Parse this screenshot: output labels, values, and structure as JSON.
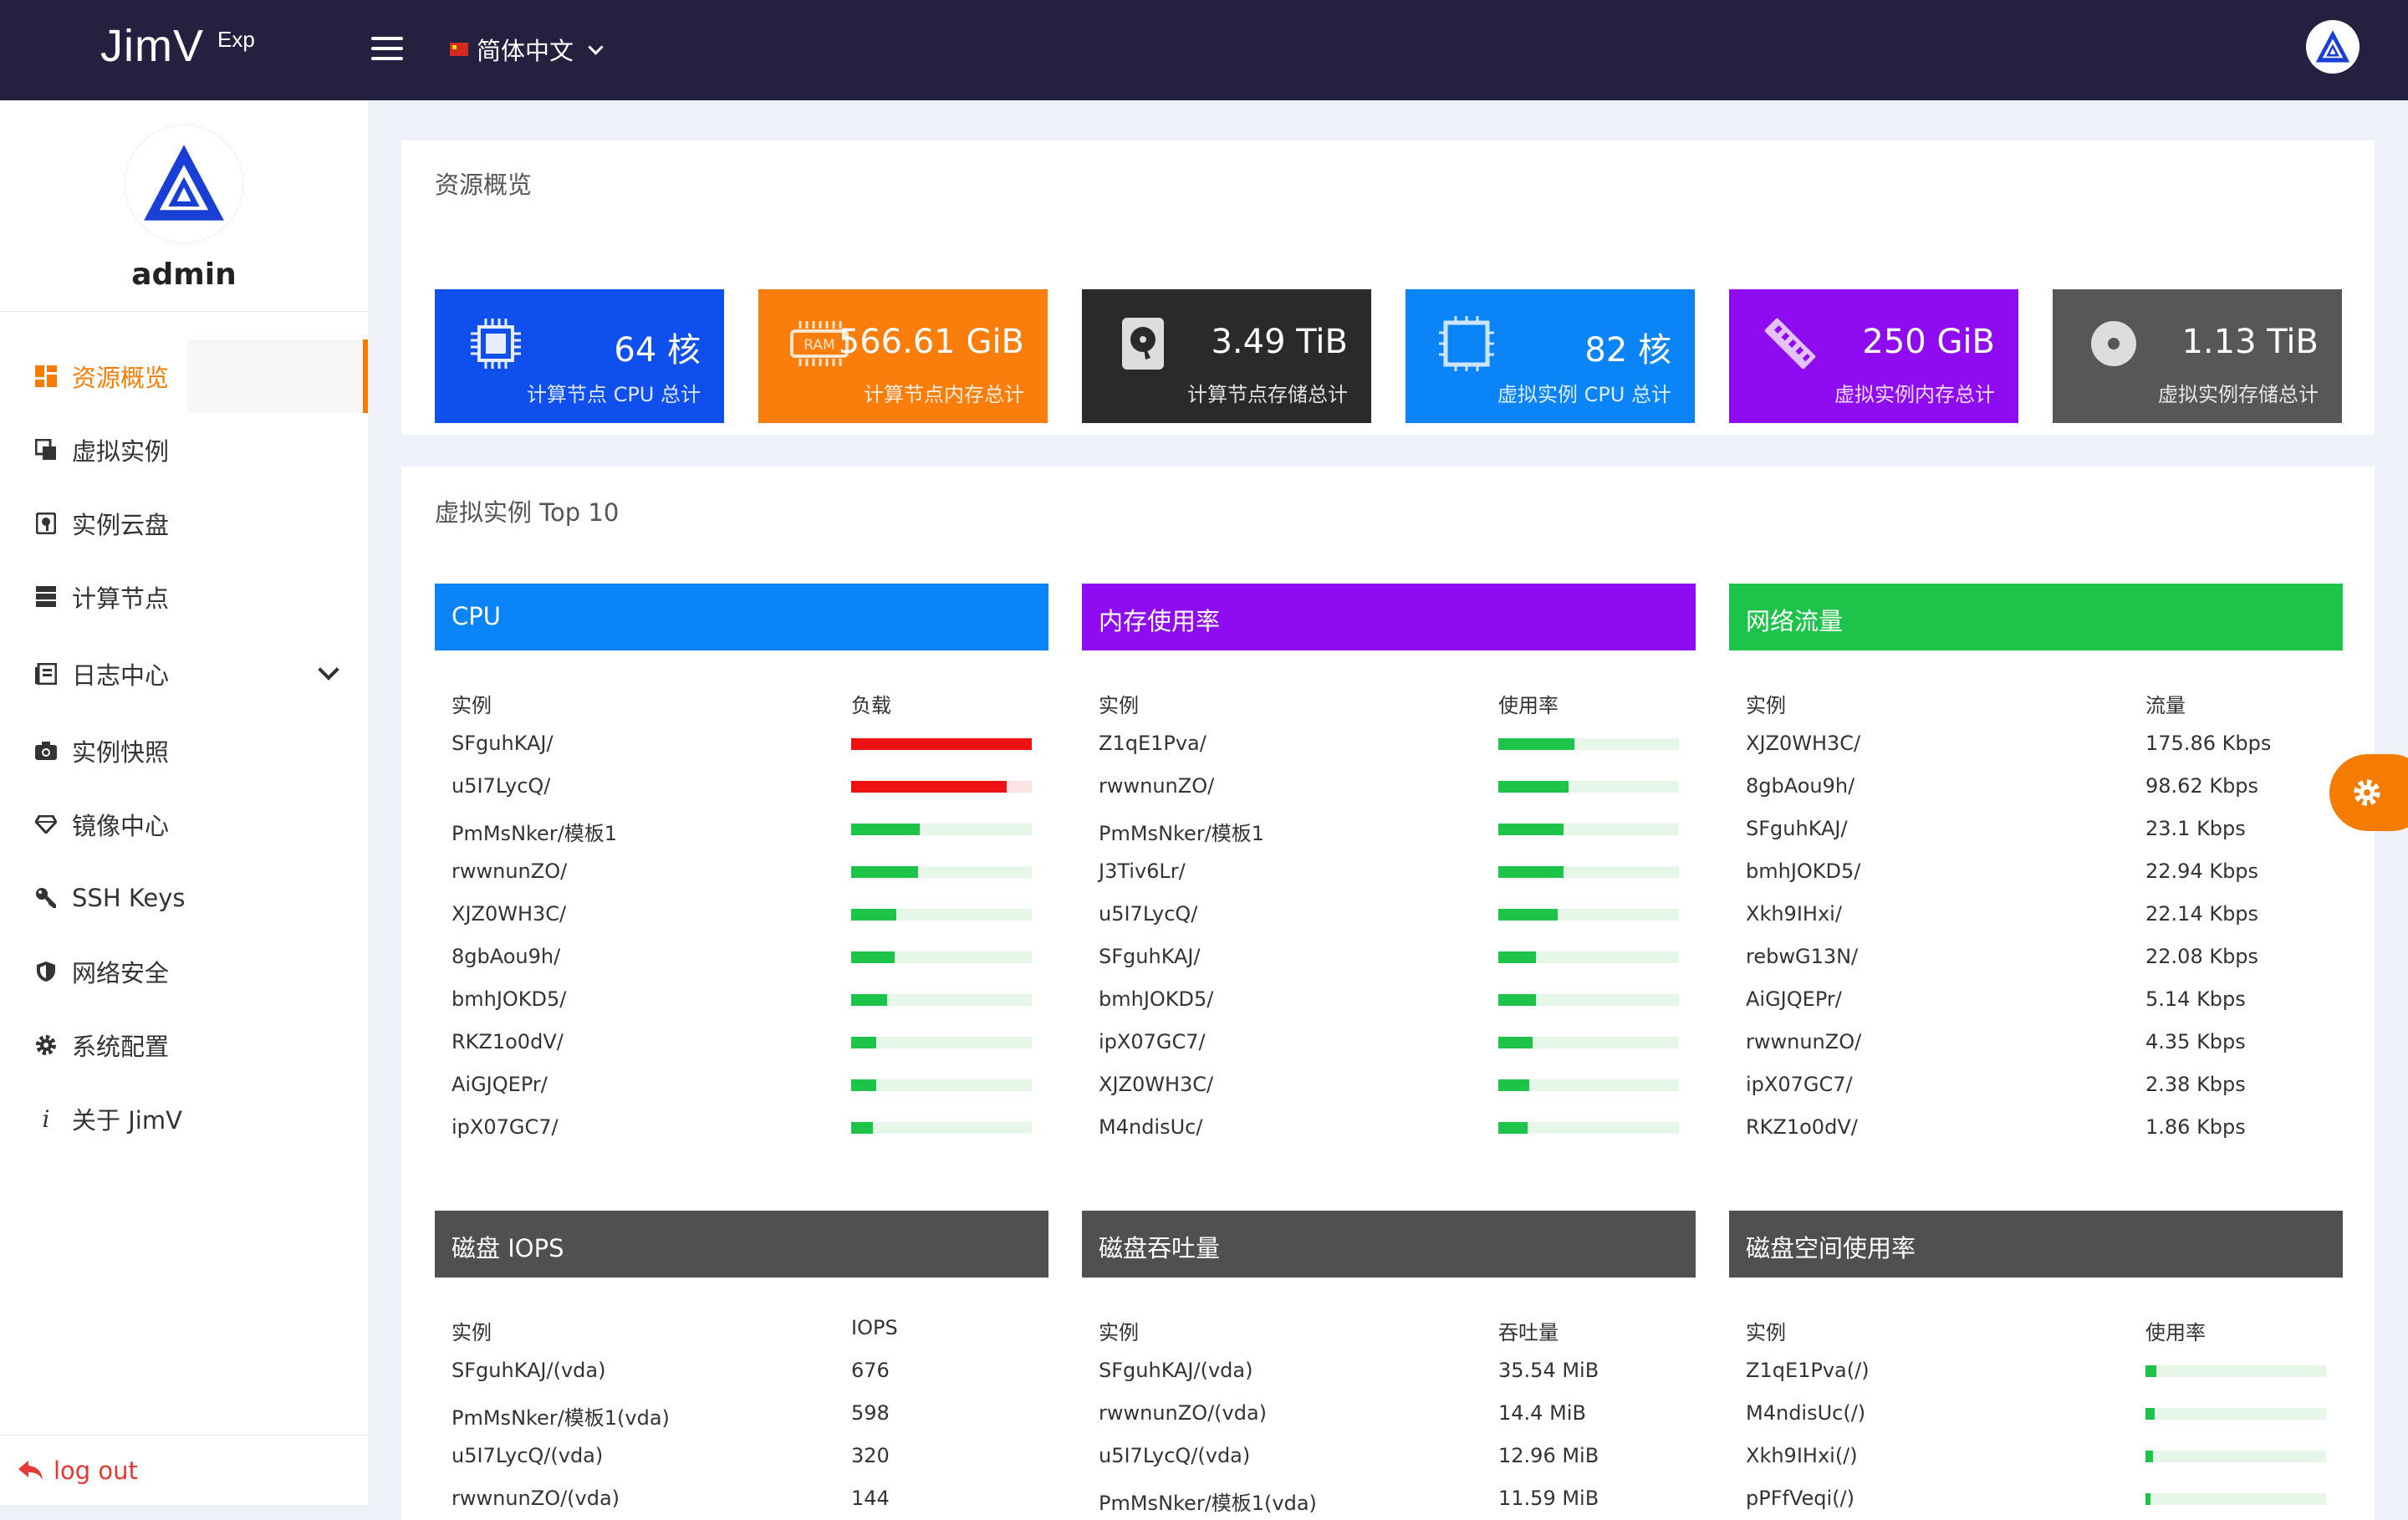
{
  "header": {
    "brand": "JimV",
    "brand_sup": "Exp",
    "language": "简体中文"
  },
  "sidebar": {
    "username": "admin",
    "items": [
      {
        "label": "资源概览",
        "icon": "dashboard-icon",
        "active": true
      },
      {
        "label": "虚拟实例",
        "icon": "instance-icon"
      },
      {
        "label": "实例云盘",
        "icon": "disk-icon"
      },
      {
        "label": "计算节点",
        "icon": "server-icon"
      },
      {
        "label": "日志中心",
        "icon": "log-icon",
        "expandable": true
      },
      {
        "label": "实例快照",
        "icon": "camera-icon"
      },
      {
        "label": "镜像中心",
        "icon": "diamond-icon"
      },
      {
        "label": "SSH Keys",
        "icon": "key-icon"
      },
      {
        "label": "网络安全",
        "icon": "shield-icon"
      },
      {
        "label": "系统配置",
        "icon": "gear-icon"
      },
      {
        "label": "关于 JimV",
        "icon": "info-icon"
      }
    ],
    "logout": "log out"
  },
  "overview": {
    "title": "资源概览",
    "stats": [
      {
        "value": "64 核",
        "label": "计算节点 CPU 总计",
        "color": "#0f4fee",
        "icon": "cpu-icon"
      },
      {
        "value": "566.61 GiB",
        "label": "计算节点内存总计",
        "color": "#fb7d0c",
        "icon": "ram-icon"
      },
      {
        "value": "3.49 TiB",
        "label": "计算节点存储总计",
        "color": "#2a2a2a",
        "icon": "harddisk-icon"
      },
      {
        "value": "82 核",
        "label": "虚拟实例 CPU 总计",
        "color": "#0a84f6",
        "icon": "chip-icon"
      },
      {
        "value": "250 GiB",
        "label": "虚拟实例内存总计",
        "color": "#8f0cf2",
        "icon": "memory-stick-icon"
      },
      {
        "value": "1.13 TiB",
        "label": "虚拟实例存储总计",
        "color": "#575757",
        "icon": "disc-icon"
      }
    ]
  },
  "top10": {
    "title": "虚拟实例 Top 10",
    "cpu": {
      "title": "CPU",
      "color": "#0a84f6",
      "col_instance": "实例",
      "col_value": "负载",
      "rows": [
        {
          "name": "SFguhKAJ/",
          "level": 1.0
        },
        {
          "name": "u5I7LycQ/",
          "level": 0.86
        },
        {
          "name": "PmMsNker/模板1",
          "level": 0.38
        },
        {
          "name": "rwwnunZO/",
          "level": 0.37
        },
        {
          "name": "XJZ0WH3C/",
          "level": 0.25
        },
        {
          "name": "8gbAou9h/",
          "level": 0.24
        },
        {
          "name": "bmhJOKD5/",
          "level": 0.2
        },
        {
          "name": "RKZ1o0dV/",
          "level": 0.14
        },
        {
          "name": "AiGJQEPr/",
          "level": 0.14
        },
        {
          "name": "ipX07GC7/",
          "level": 0.12
        }
      ]
    },
    "memory": {
      "title": "内存使用率",
      "color": "#8f0cf2",
      "col_instance": "实例",
      "col_value": "使用率",
      "rows": [
        {
          "name": "Z1qE1Pva/",
          "level": 0.42
        },
        {
          "name": "rwwnunZO/",
          "level": 0.39
        },
        {
          "name": "PmMsNker/模板1",
          "level": 0.36
        },
        {
          "name": "J3Tiv6Lr/",
          "level": 0.36
        },
        {
          "name": "u5I7LycQ/",
          "level": 0.33
        },
        {
          "name": "SFguhKAJ/",
          "level": 0.21
        },
        {
          "name": "bmhJOKD5/",
          "level": 0.21
        },
        {
          "name": "ipX07GC7/",
          "level": 0.19
        },
        {
          "name": "XJZ0WH3C/",
          "level": 0.17
        },
        {
          "name": "M4ndisUc/",
          "level": 0.16
        }
      ]
    },
    "network": {
      "title": "网络流量",
      "color": "#1ec44a",
      "col_instance": "实例",
      "col_value": "流量",
      "rows": [
        {
          "name": "XJZ0WH3C/",
          "value": "175.86 Kbps"
        },
        {
          "name": "8gbAou9h/",
          "value": "98.62 Kbps"
        },
        {
          "name": "SFguhKAJ/",
          "value": "23.1 Kbps"
        },
        {
          "name": "bmhJOKD5/",
          "value": "22.94 Kbps"
        },
        {
          "name": "Xkh9IHxi/",
          "value": "22.14 Kbps"
        },
        {
          "name": "rebwG13N/",
          "value": "22.08 Kbps"
        },
        {
          "name": "AiGJQEPr/",
          "value": "5.14 Kbps"
        },
        {
          "name": "rwwnunZO/",
          "value": "4.35 Kbps"
        },
        {
          "name": "ipX07GC7/",
          "value": "2.38 Kbps"
        },
        {
          "name": "RKZ1o0dV/",
          "value": "1.86 Kbps"
        }
      ]
    },
    "iops": {
      "title": "磁盘 IOPS",
      "color": "#505050",
      "col_instance": "实例",
      "col_value": "IOPS",
      "rows": [
        {
          "name": "SFguhKAJ/(vda)",
          "value": "676"
        },
        {
          "name": "PmMsNker/模板1(vda)",
          "value": "598"
        },
        {
          "name": "u5I7LycQ/(vda)",
          "value": "320"
        },
        {
          "name": "rwwnunZO/(vda)",
          "value": "144"
        }
      ]
    },
    "throughput": {
      "title": "磁盘吞吐量",
      "color": "#505050",
      "col_instance": "实例",
      "col_value": "吞吐量",
      "rows": [
        {
          "name": "SFguhKAJ/(vda)",
          "value": "35.54 MiB"
        },
        {
          "name": "rwwnunZO/(vda)",
          "value": "14.4 MiB"
        },
        {
          "name": "u5I7LycQ/(vda)",
          "value": "12.96 MiB"
        },
        {
          "name": "PmMsNker/模板1(vda)",
          "value": "11.59 MiB"
        }
      ]
    },
    "disk_usage": {
      "title": "磁盘空间使用率",
      "color": "#505050",
      "col_instance": "实例",
      "col_value": "使用率",
      "rows": [
        {
          "name": "Z1qE1Pva(/)",
          "level": 0.06
        },
        {
          "name": "M4ndisUc(/)",
          "level": 0.05
        },
        {
          "name": "Xkh9IHxi(/)",
          "level": 0.04
        },
        {
          "name": "pPFfVeqi(/)",
          "level": 0.03
        }
      ]
    }
  }
}
